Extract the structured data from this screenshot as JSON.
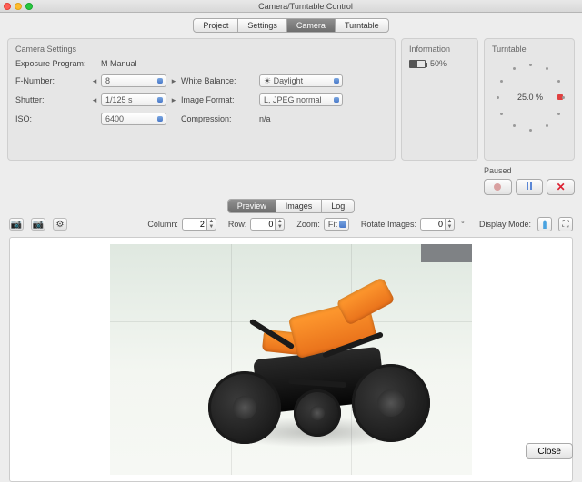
{
  "window": {
    "title": "Camera/Turntable Control"
  },
  "top_tabs": {
    "items": [
      "Project",
      "Settings",
      "Camera",
      "Turntable"
    ],
    "active": 2
  },
  "camera_settings": {
    "title": "Camera Settings",
    "exposure_program_label": "Exposure Program:",
    "exposure_program_value": "M  Manual",
    "fnumber_label": "F-Number:",
    "fnumber_value": "8",
    "white_balance_label": "White Balance:",
    "white_balance_value": "☀ Daylight",
    "shutter_label": "Shutter:",
    "shutter_value": "1/125 s",
    "image_format_label": "Image Format:",
    "image_format_value": "L, JPEG normal",
    "iso_label": "ISO:",
    "iso_value": "6400",
    "compression_label": "Compression:",
    "compression_value": "n/a"
  },
  "information": {
    "title": "Information",
    "battery_label": "50%",
    "battery_pct": 50
  },
  "turntable": {
    "title": "Turntable",
    "center_label": "25.0 %",
    "paused_label": "Paused"
  },
  "mid_tabs": {
    "items": [
      "Preview",
      "Images",
      "Log"
    ],
    "active": 0
  },
  "toolbar": {
    "column_label": "Column:",
    "column_value": "2",
    "row_label": "Row:",
    "row_value": "0",
    "zoom_label": "Zoom:",
    "zoom_value": "Fit",
    "rotate_label": "Rotate Images:",
    "rotate_value": "0",
    "rotate_unit": "°",
    "display_mode_label": "Display Mode:"
  },
  "footer": {
    "close_label": "Close"
  }
}
